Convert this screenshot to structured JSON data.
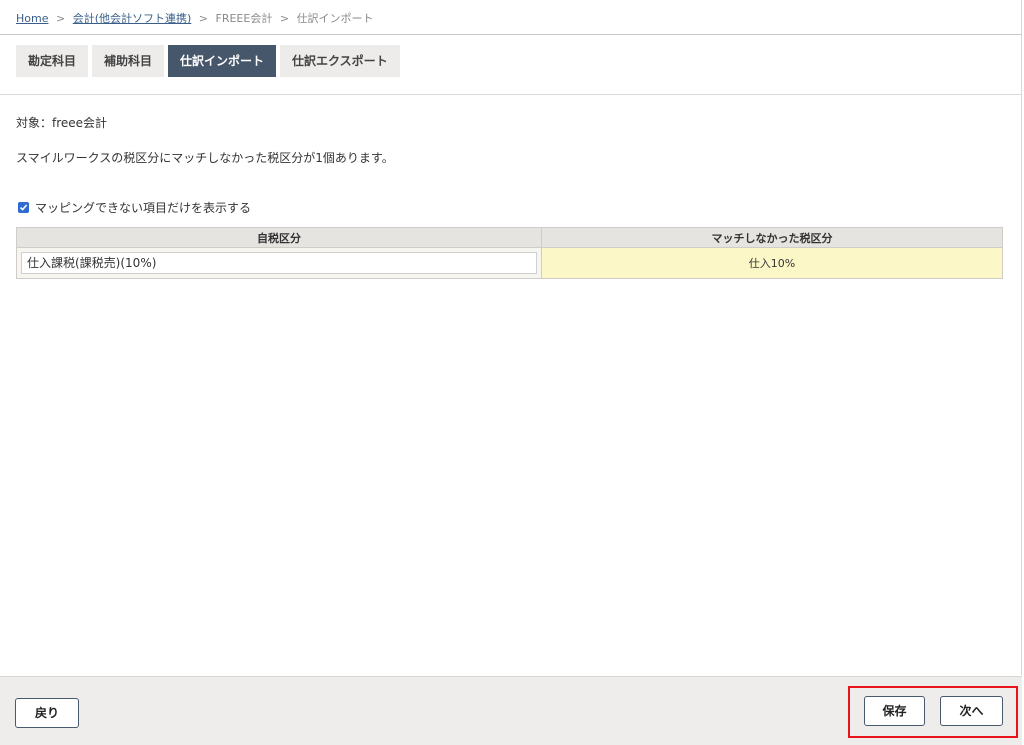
{
  "breadcrumb": {
    "home": "Home",
    "sep": ">",
    "accounting_link": "会計(他会計ソフト連携)",
    "software": "FREEE会計",
    "current": "仕訳インポート"
  },
  "tabs": [
    {
      "label": "勘定科目",
      "active": false
    },
    {
      "label": "補助科目",
      "active": false
    },
    {
      "label": "仕訳インポート",
      "active": true
    },
    {
      "label": "仕訳エクスポート",
      "active": false
    }
  ],
  "target_label": "対象：freee会計",
  "message": "スマイルワークスの税区分にマッチしなかった税区分が1個あります。",
  "filter": {
    "checked": true,
    "label": "マッピングできない項目だけを表示する"
  },
  "table": {
    "headers": [
      "自税区分",
      "マッチしなかった税区分"
    ],
    "rows": [
      {
        "own": "仕入課税(課税売)(10%)",
        "unmatched": "仕入10%"
      }
    ]
  },
  "footer": {
    "back_label": "戻り",
    "save_label": "保存",
    "next_label": "次へ"
  },
  "colors": {
    "active_tab": "#46566b",
    "unmatched_cell": "#fbf7c6",
    "highlight": "#e8141c",
    "link": "#3a5f8a"
  }
}
